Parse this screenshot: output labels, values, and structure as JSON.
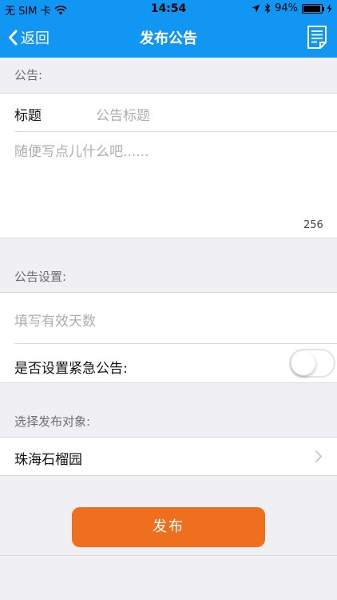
{
  "status_bar": {
    "carrier": "无 SIM 卡",
    "time": "14:54",
    "battery_text": "94%",
    "battery_level": 0.94
  },
  "nav": {
    "back_label": "返回",
    "title": "发布公告"
  },
  "announcement": {
    "section_label": "公告:",
    "title_label": "标题",
    "title_placeholder": "公告标题",
    "body_placeholder": "随便写点儿什么吧......",
    "char_limit": "256"
  },
  "settings": {
    "section_label": "公告设置:",
    "days_placeholder": "填写有效天数",
    "urgent_label": "是否设置紧急公告:",
    "urgent_enabled": false
  },
  "target": {
    "section_label": "选择发布对象:",
    "selected": "珠海石榴园"
  },
  "actions": {
    "publish_label": "发布"
  },
  "colors": {
    "nav_bg": "#1296f3",
    "button_bg": "#ee6f1e",
    "page_bg": "#efeff4"
  }
}
